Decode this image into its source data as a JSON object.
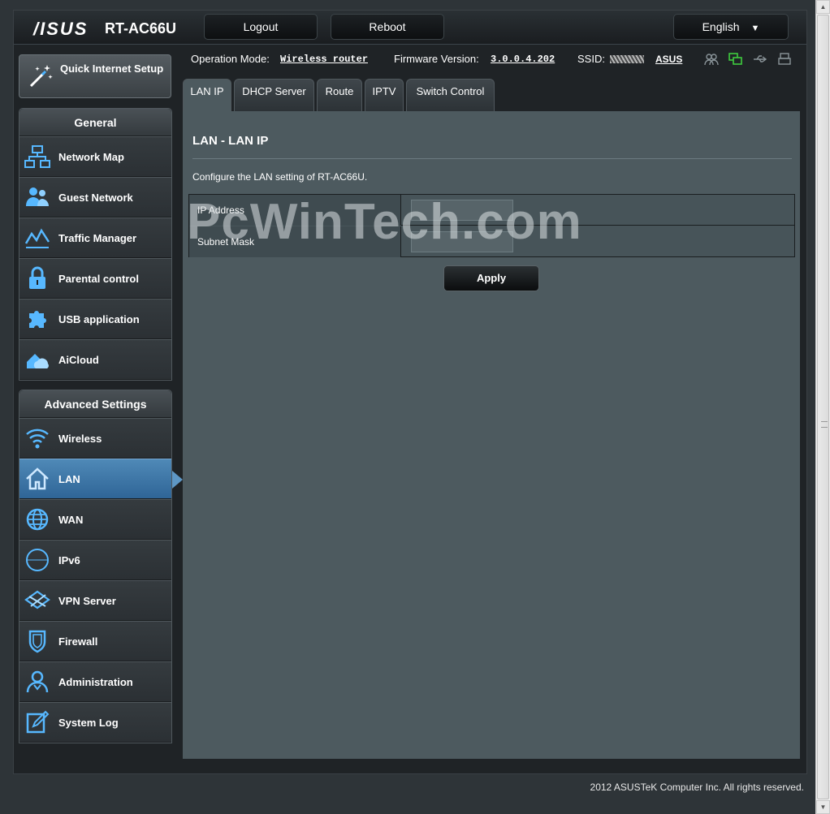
{
  "header": {
    "logo": "/ISUS",
    "model": "RT-AC66U",
    "logout_label": "Logout",
    "reboot_label": "Reboot",
    "language": "English"
  },
  "status": {
    "op_mode_label": "Operation Mode:",
    "op_mode_value": "Wireless router",
    "fw_label": "Firmware Version:",
    "fw_value": "3.0.0.4.202",
    "ssid_label": "SSID:",
    "ssid_value": "ASUS",
    "icons": [
      "clients-icon",
      "network-icon",
      "usb-icon",
      "printer-icon"
    ]
  },
  "sidebar": {
    "quick_setup": "Quick Internet Setup",
    "general_title": "General",
    "general_items": [
      {
        "label": "Network Map",
        "icon": "network-map-icon"
      },
      {
        "label": "Guest Network",
        "icon": "guest-network-icon"
      },
      {
        "label": "Traffic Manager",
        "icon": "traffic-manager-icon"
      },
      {
        "label": "Parental control",
        "icon": "lock-icon"
      },
      {
        "label": "USB application",
        "icon": "puzzle-icon"
      },
      {
        "label": "AiCloud",
        "icon": "cloud-icon"
      }
    ],
    "advanced_title": "Advanced Settings",
    "advanced_items": [
      {
        "label": "Wireless",
        "icon": "wifi-icon"
      },
      {
        "label": "LAN",
        "icon": "home-icon"
      },
      {
        "label": "WAN",
        "icon": "globe-icon"
      },
      {
        "label": "IPv6",
        "icon": "ipv6-icon"
      },
      {
        "label": "VPN Server",
        "icon": "vpn-icon"
      },
      {
        "label": "Firewall",
        "icon": "shield-icon"
      },
      {
        "label": "Administration",
        "icon": "admin-icon"
      },
      {
        "label": "System Log",
        "icon": "log-icon"
      }
    ],
    "active_item": "LAN"
  },
  "tabs": [
    "LAN IP",
    "DHCP Server",
    "Route",
    "IPTV",
    "Switch Control"
  ],
  "active_tab": "LAN IP",
  "main": {
    "title": "LAN - LAN IP",
    "description": "Configure the LAN setting of RT-AC66U.",
    "fields": [
      {
        "label": "IP Address",
        "value": ""
      },
      {
        "label": "Subnet Mask",
        "value": ""
      }
    ],
    "apply_label": "Apply"
  },
  "watermark": "PcWinTech.com",
  "footer": "2012 ASUSTeK Computer Inc. All rights reserved.",
  "colors": {
    "accent": "#3d8fd0",
    "active_item": "#4f89b7",
    "content_bg": "#4d5a5f",
    "status_green": "#3ecb3e"
  }
}
